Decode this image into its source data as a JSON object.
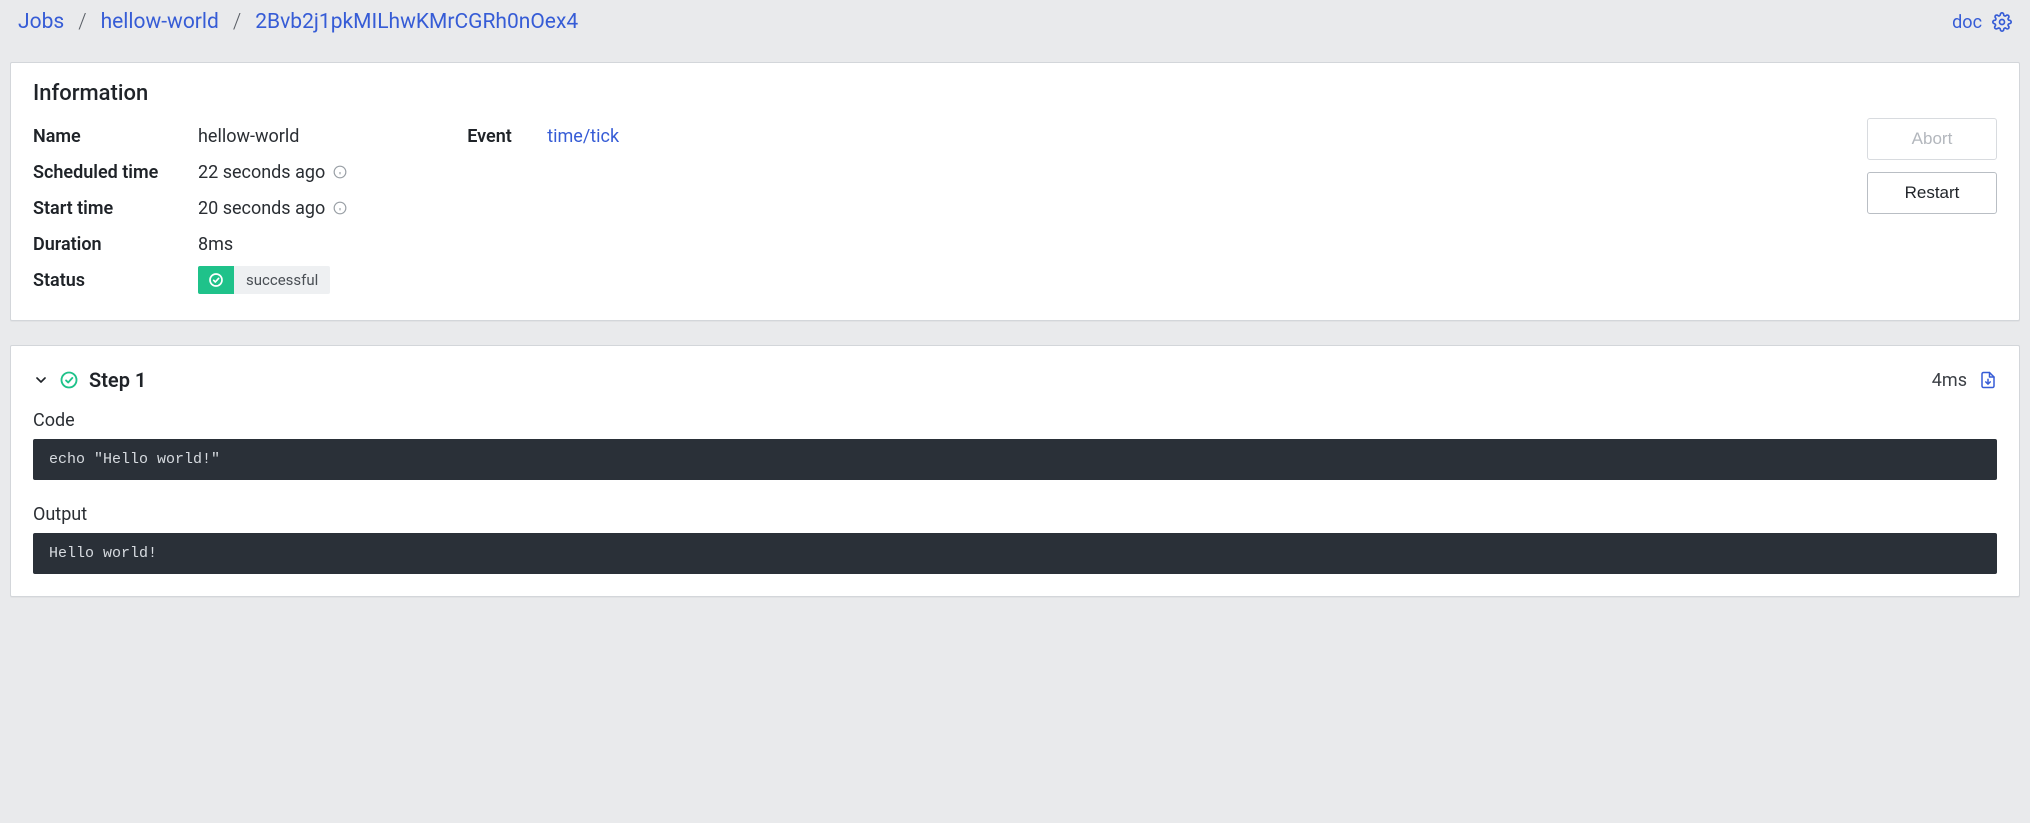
{
  "breadcrumb": {
    "root": "Jobs",
    "job": "hellow-world",
    "run_id": "2Bvb2j1pkMILhwKMrCGRh0nOex4"
  },
  "top": {
    "doc_label": "doc"
  },
  "info": {
    "title": "Information",
    "labels": {
      "name": "Name",
      "scheduled_time": "Scheduled time",
      "start_time": "Start time",
      "duration": "Duration",
      "status": "Status",
      "event": "Event"
    },
    "values": {
      "name": "hellow-world",
      "scheduled_time": "22 seconds ago",
      "start_time": "20 seconds ago",
      "duration": "8ms",
      "status_text": "successful",
      "event": "time/tick"
    },
    "actions": {
      "abort": "Abort",
      "restart": "Restart"
    }
  },
  "step": {
    "title": "Step 1",
    "duration": "4ms",
    "code_label": "Code",
    "code": "echo \"Hello world!\"",
    "output_label": "Output",
    "output": "Hello world!"
  }
}
